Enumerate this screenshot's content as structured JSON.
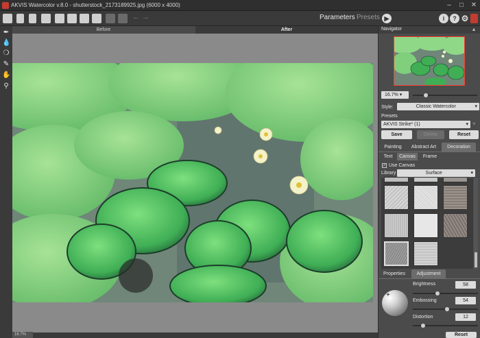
{
  "window": {
    "title": "AKVIS Watercolor v.8.0 - shutterstock_2173189925.jpg (6000 x 4000)"
  },
  "toolbar": {
    "parameters_label": "Parameters",
    "presets_label": "Presets"
  },
  "view_tabs": {
    "before": "Before",
    "after": "After"
  },
  "status": {
    "zoom": "16.7%"
  },
  "navigator": {
    "title": "Navigator",
    "zoom": "16.7%"
  },
  "style": {
    "label": "Style:",
    "value": "Classic Watercolor"
  },
  "presets": {
    "label": "Presets",
    "value": "AKVIS Strike* (1)",
    "save": "Save",
    "delete": "Delete",
    "reset": "Reset"
  },
  "main_tabs": [
    "Painting",
    "Abstract Art",
    "Decoration"
  ],
  "sub_tabs": [
    "Text",
    "Canvas",
    "Frame"
  ],
  "canvas": {
    "use_canvas_label": "Use Canvas",
    "library_label": "Library",
    "library_value": "Surface"
  },
  "bottom_tabs": [
    "Properties",
    "Adjustment"
  ],
  "adjustment": {
    "brightness_label": "Brightness",
    "brightness_value": "58",
    "embossing_label": "Embossing",
    "embossing_value": "54",
    "distortion_label": "Distortion",
    "distortion_value": "12",
    "reset": "Reset"
  },
  "colors": {
    "accent_red": "#c43b2f",
    "panel": "#4b4b4b",
    "toolbar": "#3a3a3a"
  }
}
